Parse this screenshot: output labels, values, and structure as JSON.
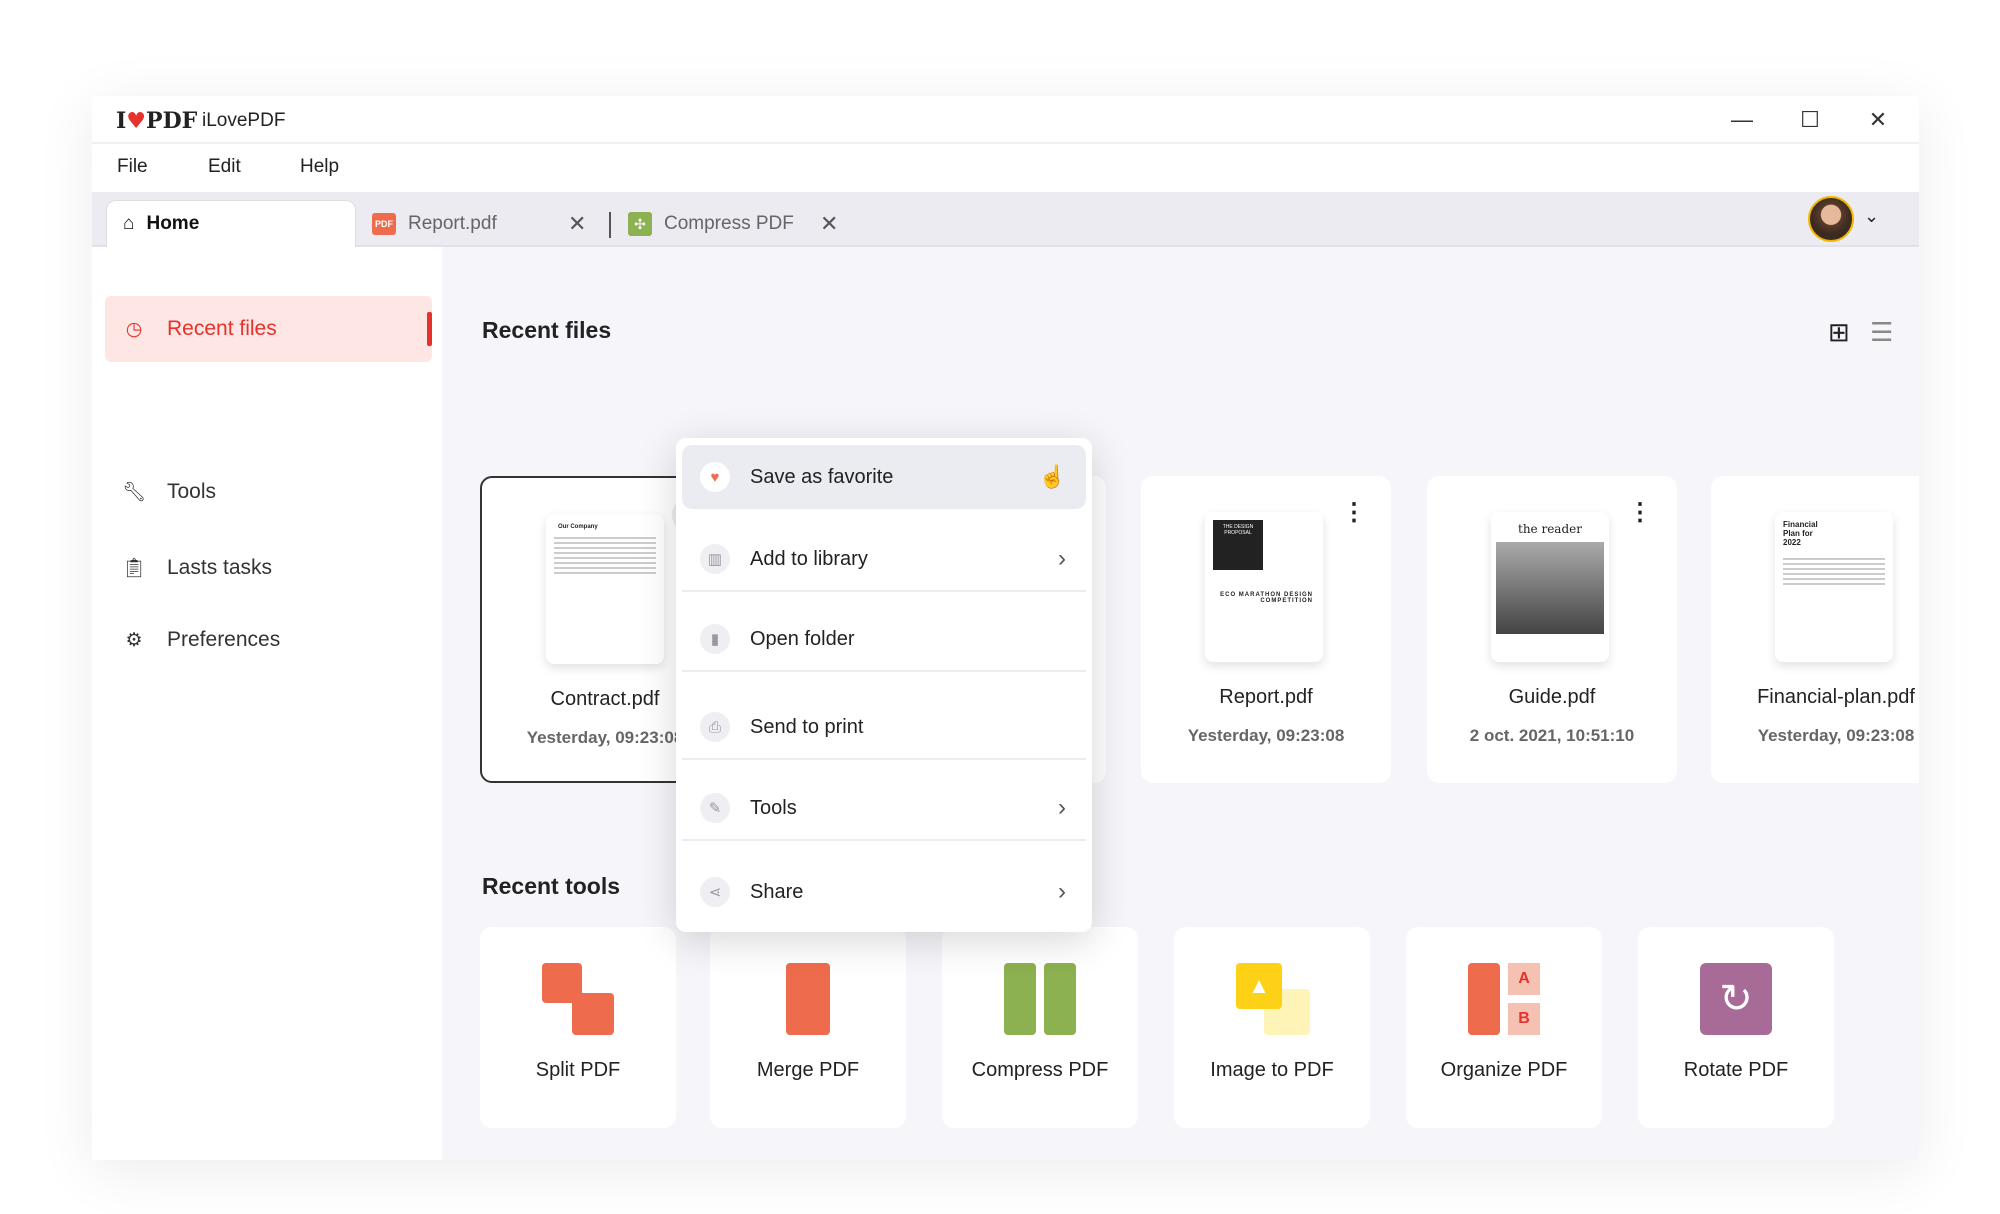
{
  "app": {
    "logo_text": "I❤PDF",
    "title": "iLovePDF"
  },
  "window_controls": {
    "minimize": "—",
    "maximize": "☐",
    "close": "✕"
  },
  "menubar": [
    "File",
    "Edit",
    "Help"
  ],
  "tabs": [
    {
      "label": "Home",
      "icon": "home-icon",
      "active": true
    },
    {
      "label": "Report.pdf",
      "icon": "pdf-file-icon",
      "closable": true
    },
    {
      "label": "Compress PDF",
      "icon": "compress-icon",
      "closable": true
    }
  ],
  "sidebar": {
    "items": [
      {
        "label": "Recent files",
        "icon": "clock-icon",
        "active": true
      },
      {
        "label": "Tools",
        "icon": "wrench-icon"
      },
      {
        "label": "Lasts tasks",
        "icon": "clipboard-icon"
      },
      {
        "label": "Preferences",
        "icon": "gear-icon"
      }
    ]
  },
  "main": {
    "recent_files_title": "Recent files",
    "recent_tools_title": "Recent tools",
    "files": [
      {
        "name": "Contract.pdf",
        "date": "Yesterday, 09:23:08",
        "selected": true
      },
      {
        "name": "",
        "date": ""
      },
      {
        "name": "Report.pdf",
        "date": "Yesterday, 09:23:08"
      },
      {
        "name": "Guide.pdf",
        "date": "2 oct. 2021, 10:51:10"
      },
      {
        "name": "Financial-plan.pdf",
        "date": "Yesterday, 09:23:08"
      }
    ],
    "thumb_text": {
      "contract": "Our Company",
      "report_a": "THE DESIGN PROPOSAL",
      "report_b": "ECO MARATHON DESIGN COMPETITION",
      "guide": "the reader",
      "financial": "Financial Plan for 2022"
    },
    "tools": [
      {
        "name": "Split PDF",
        "color": "#ee6c4d"
      },
      {
        "name": "Merge PDF",
        "color": "#ee6c4d"
      },
      {
        "name": "Compress PDF",
        "color": "#8cb150"
      },
      {
        "name": "Image to PDF",
        "color": "#fcd116"
      },
      {
        "name": "Organize PDF",
        "color": "#ee6c4d"
      },
      {
        "name": "Rotate PDF",
        "color": "#a86b97"
      }
    ]
  },
  "context_menu": [
    {
      "label": "Save as favorite",
      "icon": "heart-icon",
      "highlighted": true
    },
    {
      "label": "Add to library",
      "icon": "library-icon",
      "submenu": true
    },
    {
      "label": "Open folder",
      "icon": "file-icon"
    },
    {
      "label": "Send to print",
      "icon": "printer-icon"
    },
    {
      "label": "Tools",
      "icon": "wrench-icon",
      "submenu": true
    },
    {
      "label": "Share",
      "icon": "share-icon",
      "submenu": true
    }
  ],
  "colors": {
    "accent": "#e5322d",
    "main_bg": "#f5f5fa",
    "tabbar_bg": "#ebebf1"
  }
}
